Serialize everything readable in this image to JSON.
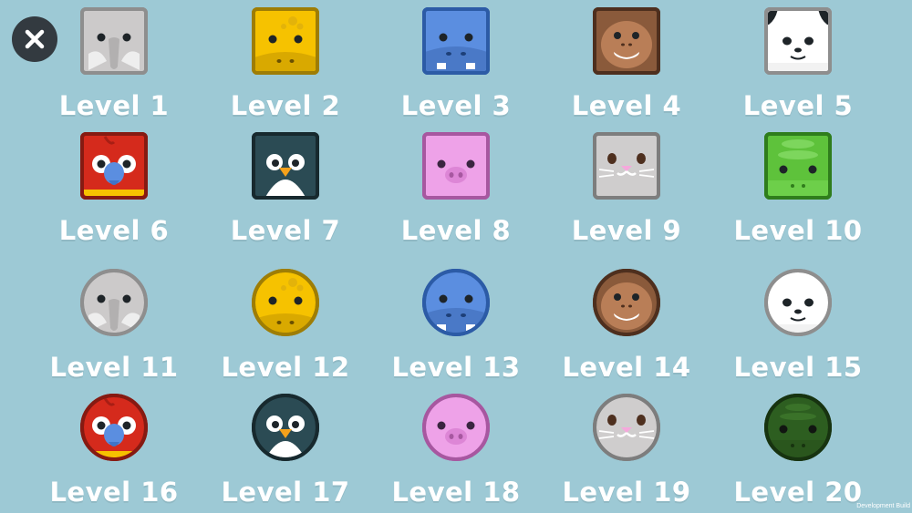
{
  "close_button": {
    "icon": "close-icon"
  },
  "levels": [
    {
      "label": "Level 1",
      "animal": "elephant",
      "shape": "square"
    },
    {
      "label": "Level 2",
      "animal": "giraffe",
      "shape": "square"
    },
    {
      "label": "Level 3",
      "animal": "hippo",
      "shape": "square"
    },
    {
      "label": "Level 4",
      "animal": "monkey",
      "shape": "square"
    },
    {
      "label": "Level 5",
      "animal": "panda",
      "shape": "square"
    },
    {
      "label": "Level 6",
      "animal": "parrot",
      "shape": "square"
    },
    {
      "label": "Level 7",
      "animal": "penguin",
      "shape": "square"
    },
    {
      "label": "Level 8",
      "animal": "pig",
      "shape": "square"
    },
    {
      "label": "Level 9",
      "animal": "rabbit",
      "shape": "square"
    },
    {
      "label": "Level 10",
      "animal": "snake",
      "shape": "square"
    },
    {
      "label": "Level 11",
      "animal": "elephant",
      "shape": "circle"
    },
    {
      "label": "Level 12",
      "animal": "giraffe",
      "shape": "circle"
    },
    {
      "label": "Level 13",
      "animal": "hippo",
      "shape": "circle"
    },
    {
      "label": "Level 14",
      "animal": "monkey",
      "shape": "circle"
    },
    {
      "label": "Level 15",
      "animal": "panda",
      "shape": "circle"
    },
    {
      "label": "Level 16",
      "animal": "parrot",
      "shape": "circle"
    },
    {
      "label": "Level 17",
      "animal": "penguin",
      "shape": "circle"
    },
    {
      "label": "Level 18",
      "animal": "pig",
      "shape": "circle"
    },
    {
      "label": "Level 19",
      "animal": "rabbit",
      "shape": "circle"
    },
    {
      "label": "Level 20",
      "animal": "crocodile",
      "shape": "circle"
    }
  ],
  "footer": {
    "dev_build": "Development Build"
  },
  "colors": {
    "background": "#9dc9d5",
    "label": "#ffffff",
    "close_button": "#333a40"
  }
}
